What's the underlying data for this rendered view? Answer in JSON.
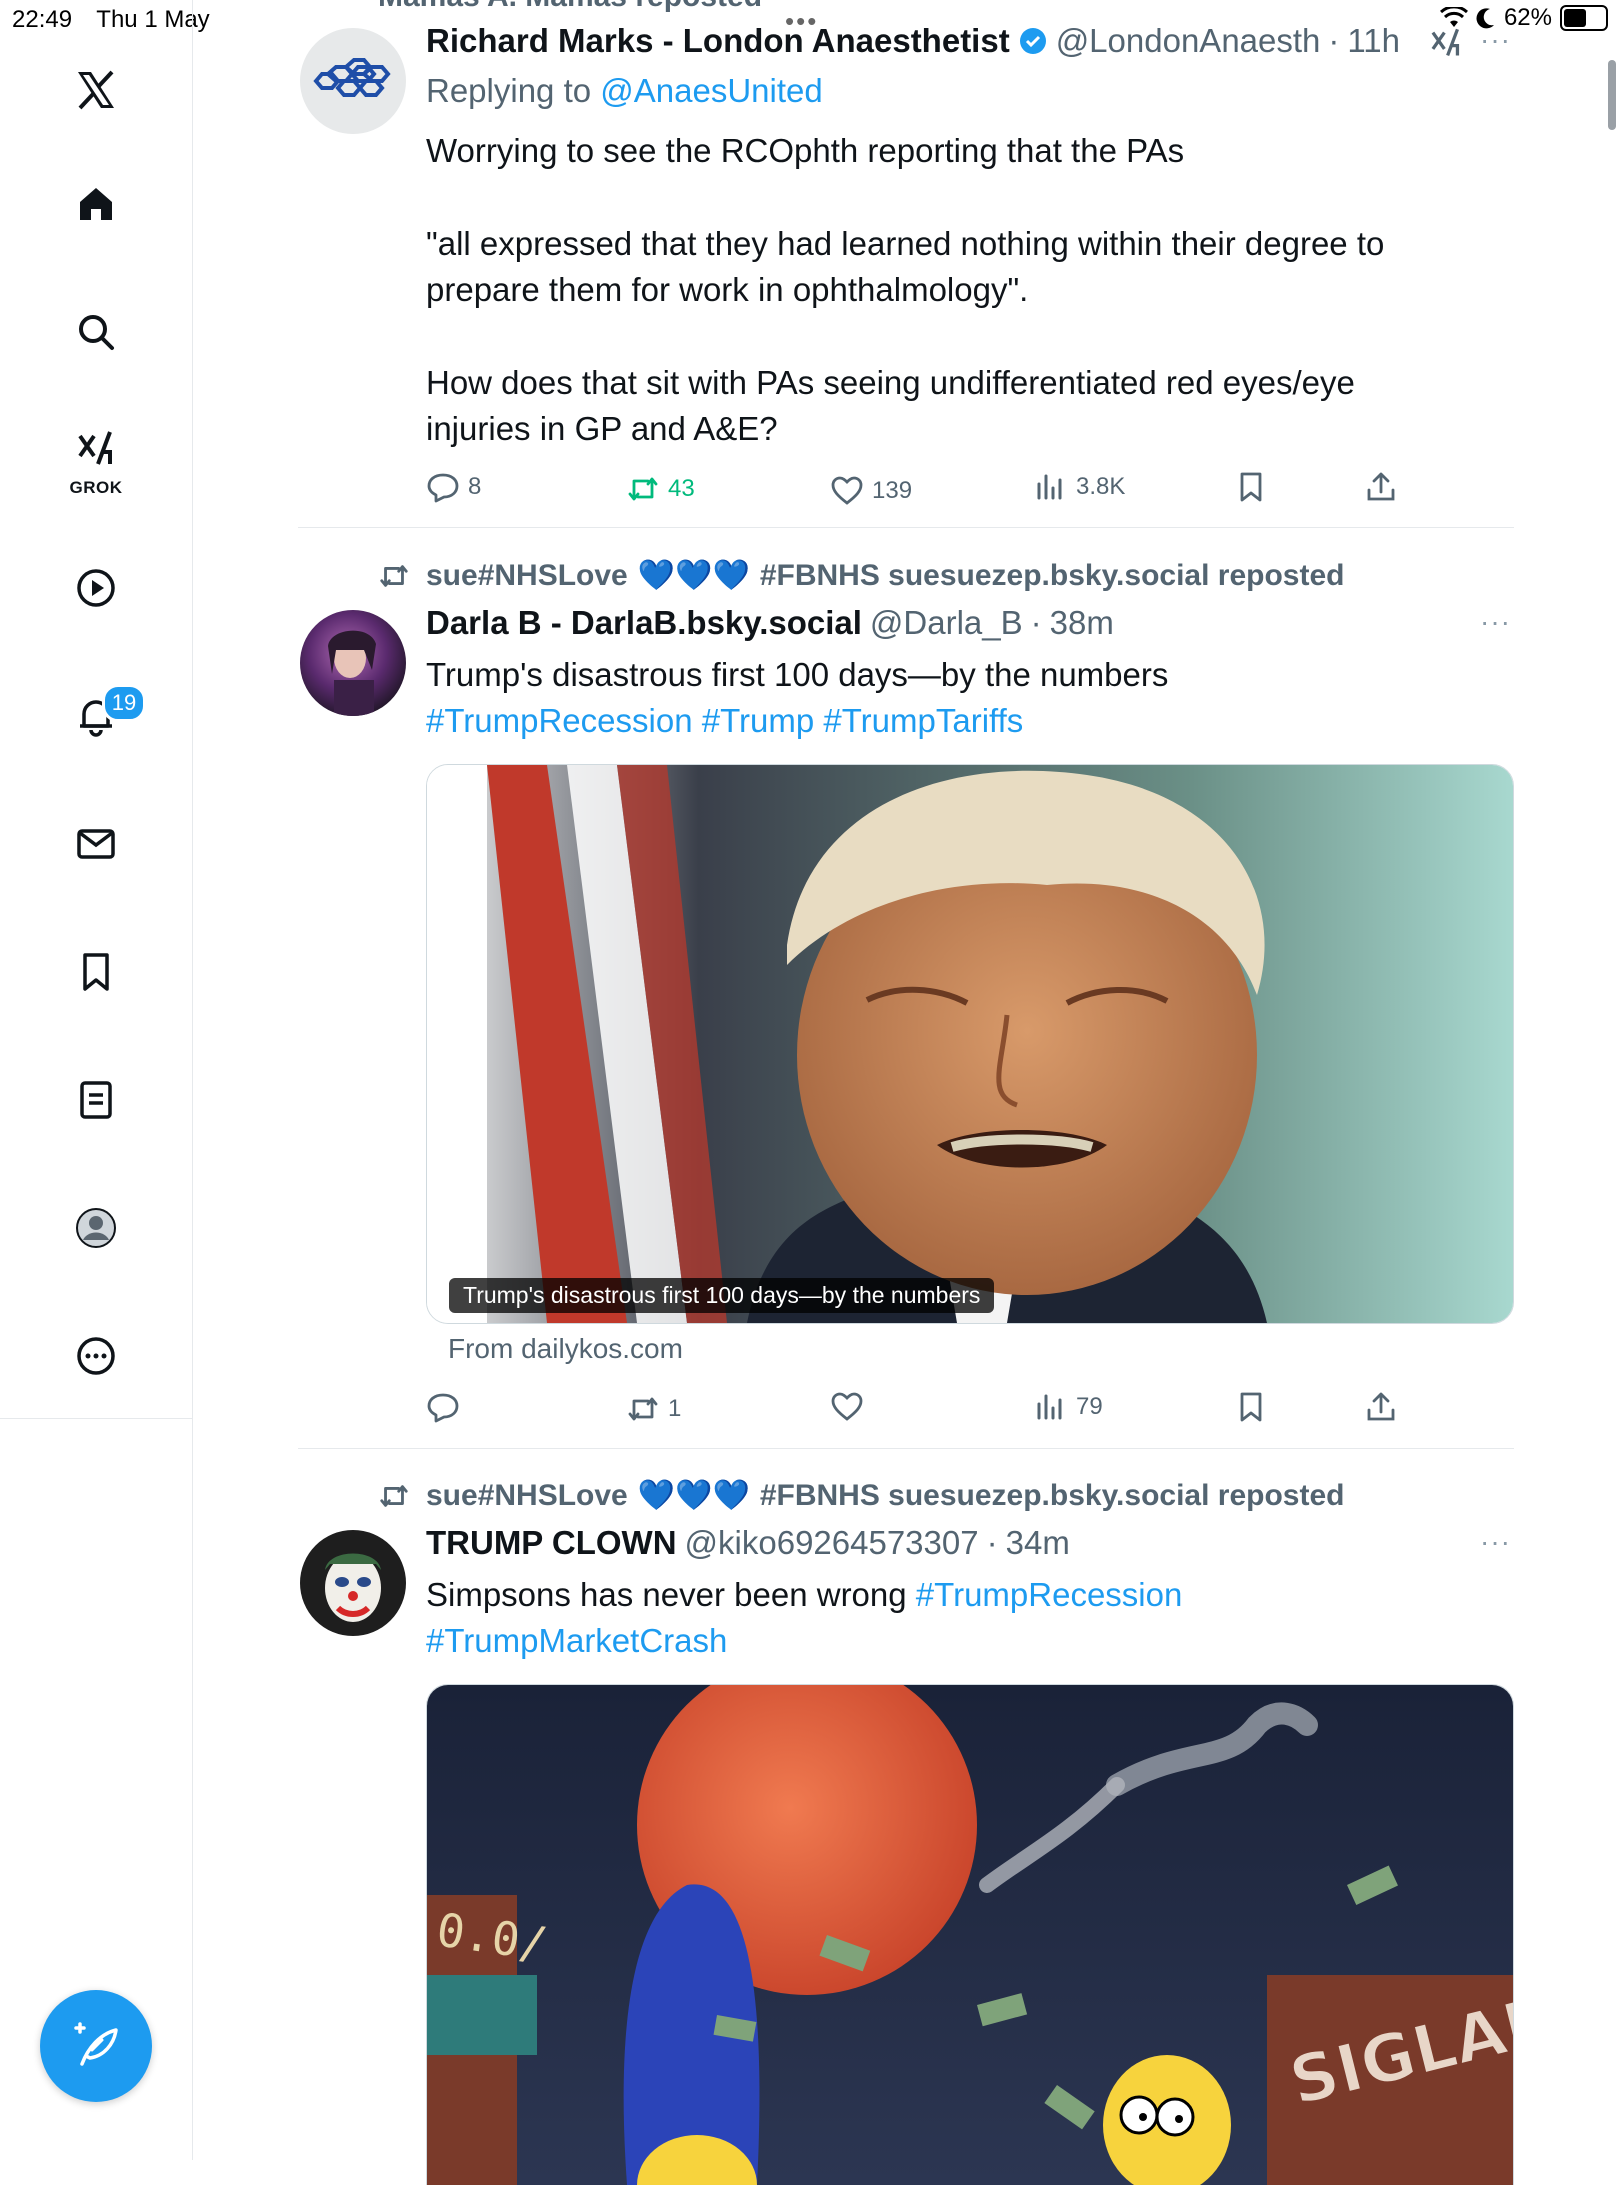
{
  "status_bar": {
    "time": "22:49",
    "date": "Thu 1 May",
    "battery": "62%",
    "battery_level": 0.62
  },
  "sidebar": {
    "grok_label": "GROK",
    "notifications_badge": "19"
  },
  "partial_repost_header": "Mamas A. Mamas reposted",
  "tweets": [
    {
      "name": "Richard Marks - London Anaesthetist",
      "handle": "@LondonAnaesth",
      "time": "11h",
      "replying_prefix": "Replying to ",
      "replying_to": "@AnaesUnited",
      "paragraphs": [
        "Worrying to see the RCOphth reporting that the PAs",
        "\"all expressed that they had learned nothing within their degree to prepare them for work in ophthalmology\".",
        "How does that sit with PAs seeing undifferentiated red eyes/eye injuries in GP and A&E?"
      ],
      "replies": "8",
      "reposts": "43",
      "likes": "139",
      "views": "3.8K"
    },
    {
      "repost_by_prefix": "sue#NHSLove",
      "repost_by_suffix": "#FBNHS suesuezep.bsky.social reposted",
      "name": "Darla B - DarlaB.bsky.social",
      "handle": "@Darla_B",
      "time": "38m",
      "text": "Trump's disastrous first 100 days—by the numbers",
      "hashtags": [
        "#TrumpRecession",
        "#Trump",
        "#TrumpTariffs"
      ],
      "card_caption": "Trump's disastrous first 100 days—by the numbers",
      "card_source": "From dailykos.com",
      "replies": "",
      "reposts": "1",
      "likes": "",
      "views": "79"
    },
    {
      "repost_by_prefix": "sue#NHSLove",
      "repost_by_suffix": "#FBNHS suesuezep.bsky.social reposted",
      "name": "TRUMP CLOWN",
      "handle": "@kiko69264573307",
      "time": "34m",
      "text": "Simpsons has never been wrong",
      "hashtags": [
        "#TrumpRecession",
        "#TrumpMarketCrash"
      ],
      "image_text_left": "0.0/",
      "image_text_right": "SIGLAD"
    }
  ],
  "separator_dot": "·",
  "ellipsis": "···",
  "colors": {
    "accent": "#1d9bf0",
    "repost_green": "#00ba7c",
    "muted": "#536471"
  }
}
